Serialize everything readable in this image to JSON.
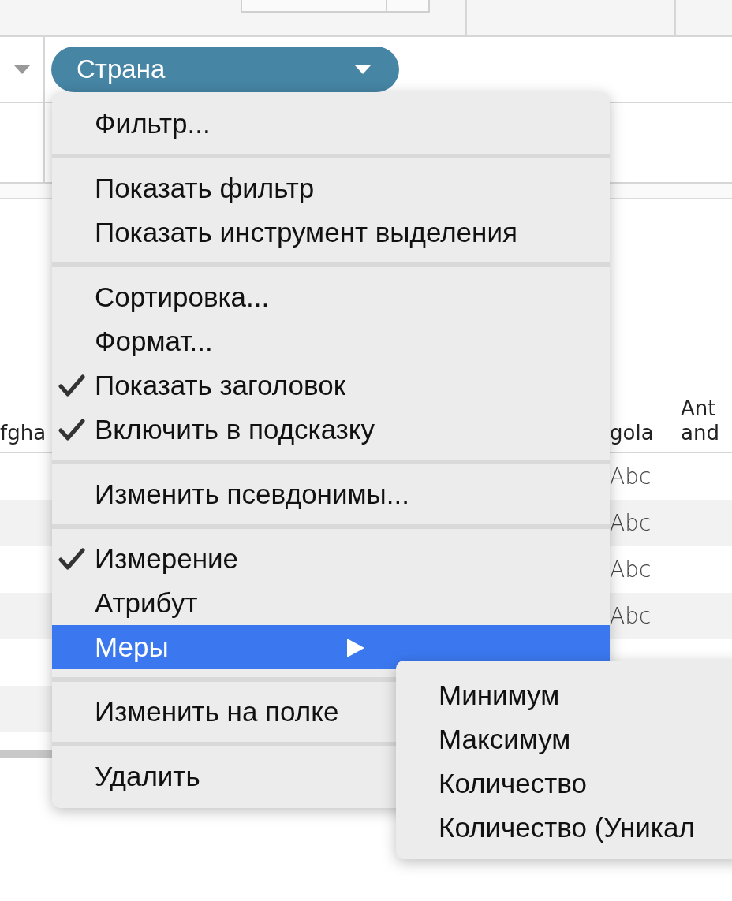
{
  "shelf": {
    "pill": {
      "label": "Страна"
    }
  },
  "table": {
    "columns": [
      {
        "header": [
          "fgha"
        ]
      },
      {
        "header": [
          "gola"
        ]
      },
      {
        "header": [
          "Ant",
          "and"
        ]
      }
    ],
    "rows": [
      {
        "cells": [
          "",
          "Abc",
          ""
        ]
      },
      {
        "cells": [
          "",
          "Abc",
          ""
        ]
      },
      {
        "cells": [
          "",
          "Abc",
          ""
        ]
      },
      {
        "cells": [
          "",
          "Abc",
          ""
        ]
      }
    ]
  },
  "menu": {
    "sections": [
      {
        "items": [
          {
            "label": "Фильтр...",
            "checked": false,
            "selected": false,
            "has_submenu": false
          }
        ]
      },
      {
        "items": [
          {
            "label": "Показать фильтр",
            "checked": false,
            "selected": false,
            "has_submenu": false
          },
          {
            "label": "Показать инструмент выделения",
            "checked": false,
            "selected": false,
            "has_submenu": false
          }
        ]
      },
      {
        "items": [
          {
            "label": "Сортировка...",
            "checked": false,
            "selected": false,
            "has_submenu": false
          },
          {
            "label": "Формат...",
            "checked": false,
            "selected": false,
            "has_submenu": false
          },
          {
            "label": "Показать заголовок",
            "checked": true,
            "selected": false,
            "has_submenu": false
          },
          {
            "label": "Включить в подсказку",
            "checked": true,
            "selected": false,
            "has_submenu": false
          }
        ]
      },
      {
        "items": [
          {
            "label": "Изменить псевдонимы...",
            "checked": false,
            "selected": false,
            "has_submenu": false
          }
        ]
      },
      {
        "items": [
          {
            "label": "Измерение",
            "checked": true,
            "selected": false,
            "has_submenu": false
          },
          {
            "label": "Атрибут",
            "checked": false,
            "selected": false,
            "has_submenu": false
          },
          {
            "label": "Меры",
            "checked": false,
            "selected": true,
            "has_submenu": true
          }
        ]
      },
      {
        "items": [
          {
            "label": "Изменить на полке",
            "checked": false,
            "selected": false,
            "has_submenu": false
          }
        ]
      },
      {
        "items": [
          {
            "label": "Удалить",
            "checked": false,
            "selected": false,
            "has_submenu": false
          }
        ]
      }
    ]
  },
  "submenu": {
    "items": [
      {
        "label": "Минимум"
      },
      {
        "label": "Максимум"
      },
      {
        "label": "Количество"
      },
      {
        "label": "Количество (Уникал"
      }
    ]
  }
}
